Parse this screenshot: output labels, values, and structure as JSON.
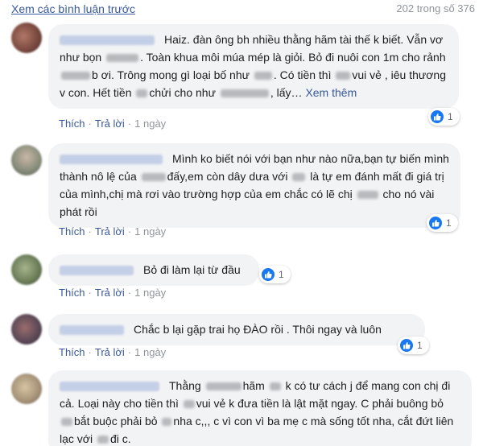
{
  "header": {
    "view_previous": "Xem các bình luận trước",
    "count": "202 trong số 376"
  },
  "comments": [
    {
      "text": "Haiz. đàn ông bh nhiều thằng hãm tài thế k biết. Vẫn vơ như bọn",
      "text2": ". Toàn khua môi múa mép là giỏi. Bỏ đi nuôi con 1m cho rảnh",
      "text3": "b ơi. Trông mong gì loại bố như",
      "text4": "Có tiền thì",
      "text5": "vui vẻ , iêu thương v con. Hết tiền",
      "text6": "chửi cho như",
      "text7": "lấy…",
      "see_more": "Xem thêm",
      "like": "Thích",
      "reply": "Trả lời",
      "time": "1 ngày",
      "reactions": "1"
    },
    {
      "text": "Mình ko biết nói với bạn như nào nữa,bạn tự biến mình thành nô lệ của",
      "text2": "đấy,em còn dây dưa với",
      "text3": "là tự em đánh mất đi giá trị của mình,chị mà rơi vào trường hợp của em chắc có lẽ chị",
      "text4": "cho nó vài phát rồi",
      "like": "Thích",
      "reply": "Trả lời",
      "time": "1 ngày",
      "reactions": "1"
    },
    {
      "text": "Bỏ đi làm lại từ đầu",
      "like": "Thích",
      "reply": "Trả lời",
      "time": "1 ngày",
      "reactions": "1"
    },
    {
      "text": "Chắc b lại gặp trai họ ĐÀO rồi . Thôi ngay và luôn",
      "like": "Thích",
      "reply": "Trả lời",
      "time": "1 ngày",
      "reactions": "1"
    },
    {
      "text": "Thằng",
      "text2": "hãm",
      "text3": "k có tư cách j để mang con chị đi cả. Loại này cho tiền thì",
      "text4": "vui vẻ k đưa tiền là lật mặt ngay. C phải buông bỏ",
      "text5": "bắt buộc phải bỏ",
      "text6": "nha c,,, c vì con vì ba mẹ c mà sống tốt nha, cắt đứt liên lạc với",
      "text7": "đi c."
    }
  ],
  "colors": {
    "link": "#385898",
    "bubble": "#f2f3f5",
    "muted": "#90949c",
    "like": "#1877f2"
  }
}
